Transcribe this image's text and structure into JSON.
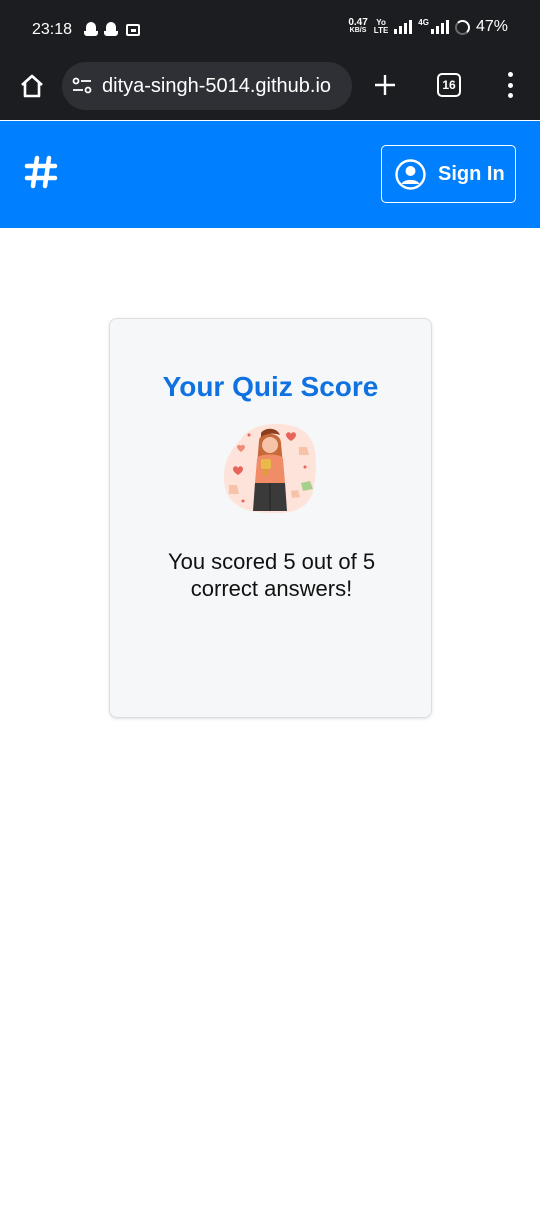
{
  "status_bar": {
    "time": "23:18",
    "net_speed_value": "0.47",
    "net_speed_unit": "KB/S",
    "volte_top": "Yo",
    "volte_bottom": "LTE",
    "network_type": "4G",
    "battery_percent": "47%",
    "icons": [
      "snapchat-icon",
      "snapchat-icon",
      "window-icon",
      "signal-icon",
      "battery-icon"
    ]
  },
  "browser": {
    "url": "ditya-singh-5014.github.io",
    "tab_count": "16",
    "icons": [
      "home-icon",
      "tune-icon",
      "plus-icon",
      "more-vert-icon"
    ]
  },
  "header": {
    "logo_icon": "hashtag-icon",
    "sign_in_label": "Sign In",
    "sign_in_icon": "user-circle-icon",
    "accent_color": "#0080ff"
  },
  "quiz_result": {
    "title": "Your Quiz Score",
    "illustration": "celebration-illustration",
    "score_line1": "You scored 5 out of 5",
    "score_line2": "correct answers!",
    "score": 5,
    "total": 5,
    "title_color": "#0f72e0"
  }
}
